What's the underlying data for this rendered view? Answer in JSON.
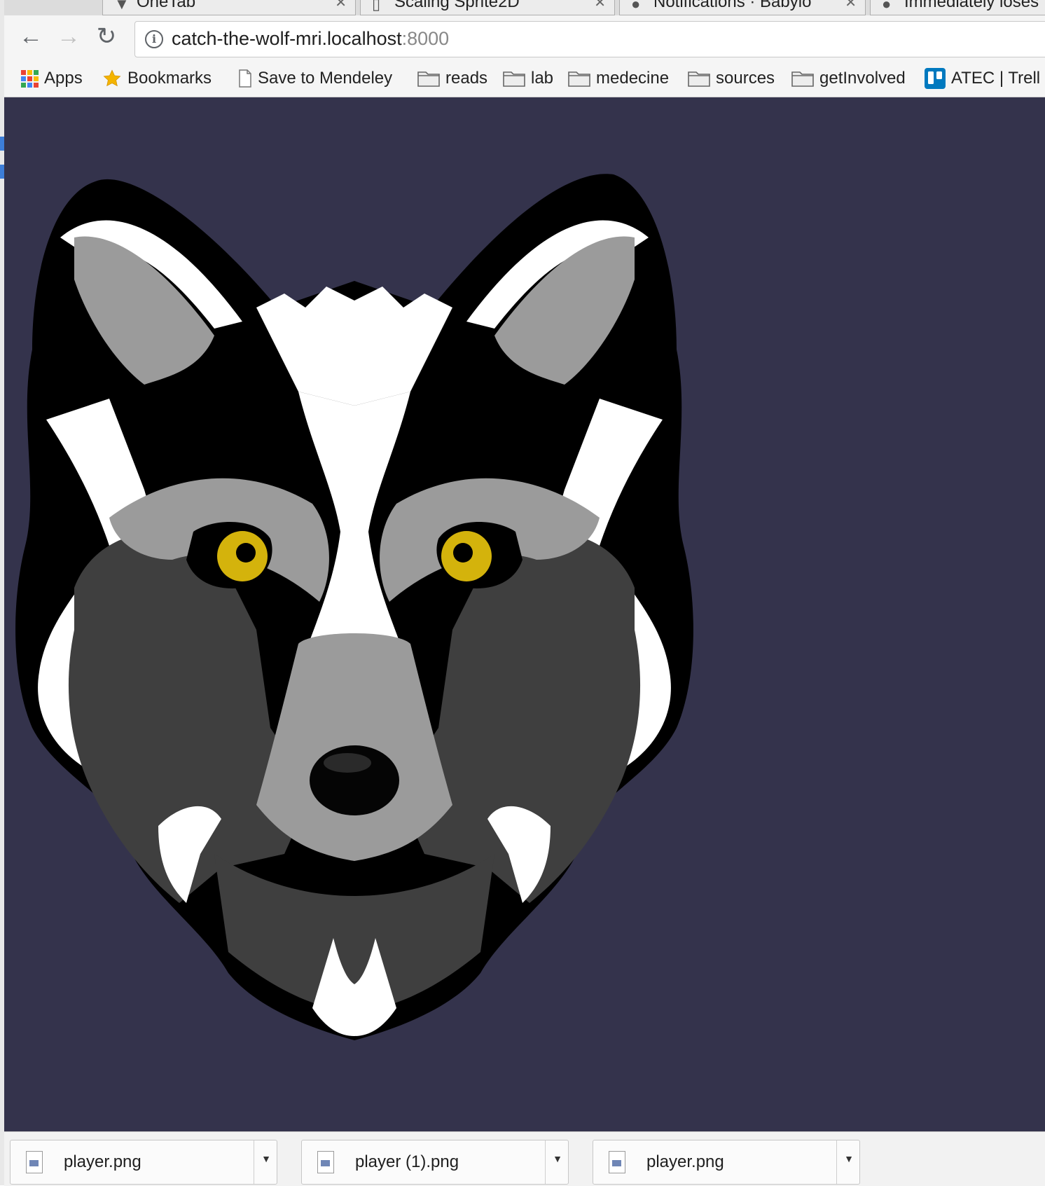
{
  "tabs": [
    {
      "title": "OneTab"
    },
    {
      "title": "Scaling Sprite2D"
    },
    {
      "title": "Notifications · Babylo"
    },
    {
      "title": "Immediately loses"
    }
  ],
  "toolbar": {
    "back_icon": "arrow-left",
    "forward_icon": "arrow-right",
    "reload_icon": "reload",
    "url_host": "catch-the-wolf-mri.localhost",
    "url_port": ":8000"
  },
  "bookmarks": [
    {
      "label": "Apps",
      "icon": "apps-grid-icon"
    },
    {
      "label": "Bookmarks",
      "icon": "star-icon"
    },
    {
      "label": "Save to Mendeley",
      "icon": "page-icon"
    },
    {
      "label": "reads",
      "icon": "folder-icon"
    },
    {
      "label": "lab",
      "icon": "folder-icon"
    },
    {
      "label": "medecine",
      "icon": "folder-icon"
    },
    {
      "label": "sources",
      "icon": "folder-icon"
    },
    {
      "label": "getInvolved",
      "icon": "folder-icon"
    },
    {
      "label": "ATEC | Trell",
      "icon": "trello-icon"
    }
  ],
  "page": {
    "background": "#34334c",
    "image": "wolf-head-illustration"
  },
  "downloads": [
    {
      "filename": "player.png"
    },
    {
      "filename": "player (1).png"
    },
    {
      "filename": "player.png"
    }
  ],
  "colors": {
    "eye": "#d4b30c",
    "fur_dark": "#3f3f3f",
    "fur_mid": "#9b9b9b",
    "fur_light": "#ffffff"
  }
}
